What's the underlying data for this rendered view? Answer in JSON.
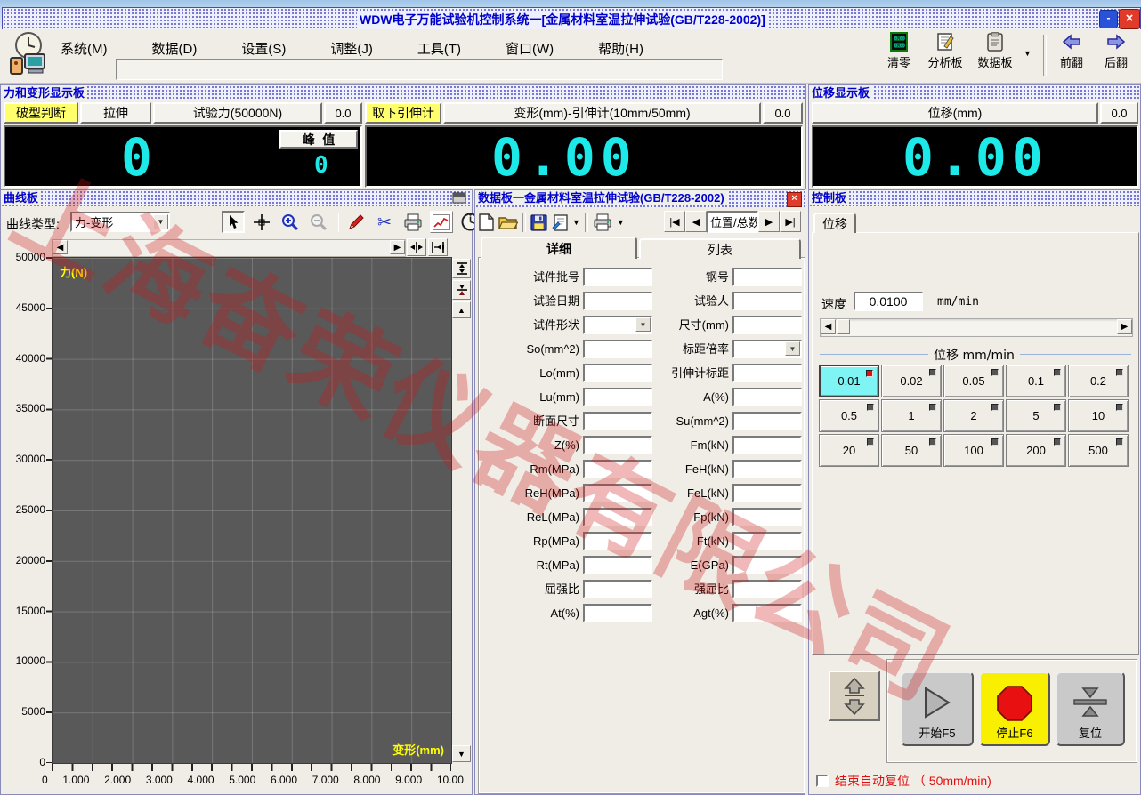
{
  "window": {
    "title": "WDW电子万能试验机控制系统一[金属材料室温拉伸试验(GB/T228-2002)]",
    "minimize_label": "-",
    "close_label": "×"
  },
  "menu": {
    "items": [
      "系统(M)",
      "数据(D)",
      "设置(S)",
      "调整(J)",
      "工具(T)",
      "窗口(W)",
      "帮助(H)"
    ]
  },
  "toolbar": {
    "clear_zero": "清零",
    "analysis_board": "分析板",
    "data_board": "数据板",
    "prev_page": "前翻",
    "next_page": "后翻"
  },
  "force_panel": {
    "title": "力和变形显示板",
    "break_judge_label": "破型判断",
    "tensile_label": "拉伸",
    "force_header": "试验力(50000N)",
    "force_small_value": "0.0",
    "force_display": "0",
    "peak_label": "峰 值",
    "peak_value": "0",
    "remove_extensometer_label": "取下引伸计",
    "deform_header": "变形(mm)-引伸计(10mm/50mm)",
    "deform_small_value": "0.0",
    "deform_display": "0.00"
  },
  "displacement_panel": {
    "title": "位移显示板",
    "header": "位移(mm)",
    "small_value": "0.0",
    "display": "0.00"
  },
  "curve_panel": {
    "title": "曲线板",
    "curve_type_label": "曲线类型:",
    "curve_type_value": "力-变形"
  },
  "chart_data": {
    "type": "line",
    "title": "",
    "xlabel": "变形(mm)",
    "ylabel": "力(N)",
    "xlim": [
      0,
      10
    ],
    "ylim": [
      0,
      50000
    ],
    "x_tick_labels": [
      "0",
      "1.000",
      "2.000",
      "3.000",
      "4.000",
      "5.000",
      "6.000",
      "7.000",
      "8.000",
      "9.000",
      "10.00"
    ],
    "y_tick_labels": [
      "50000",
      "45000",
      "40000",
      "35000",
      "30000",
      "25000",
      "20000",
      "15000",
      "10000",
      "5000",
      "0"
    ],
    "grid": true,
    "series": [],
    "plot_bg": "#595959",
    "axis_label_color": "#ffff00"
  },
  "data_panel": {
    "title": "数据板一金属材料室温拉伸试验(GB/T228-2002)",
    "close_label": "×",
    "position_label": "位置/总数",
    "tabs": [
      "详细",
      "列表"
    ],
    "rows": [
      {
        "left_label": "试件批号",
        "left_value": "",
        "right_label": "钢号",
        "right_value": ""
      },
      {
        "left_label": "试验日期",
        "left_value": "",
        "right_label": "试验人",
        "right_value": ""
      },
      {
        "left_label": "试件形状",
        "left_value": "",
        "right_label": "尺寸(mm)",
        "right_value": ""
      },
      {
        "left_label": "So(mm^2)",
        "left_value": "",
        "right_label": "标距倍率",
        "right_value": ""
      },
      {
        "left_label": "Lo(mm)",
        "left_value": "",
        "right_label": "引伸计标距",
        "right_value": ""
      },
      {
        "left_label": "Lu(mm)",
        "left_value": "",
        "right_label": "A(%)",
        "right_value": ""
      },
      {
        "left_label": "断面尺寸",
        "left_value": "",
        "right_label": "Su(mm^2)",
        "right_value": ""
      },
      {
        "left_label": "Z(%)",
        "left_value": "",
        "right_label": "Fm(kN)",
        "right_value": ""
      },
      {
        "left_label": "Rm(MPa)",
        "left_value": "",
        "right_label": "FeH(kN)",
        "right_value": ""
      },
      {
        "left_label": "ReH(MPa)",
        "left_value": "",
        "right_label": "FeL(kN)",
        "right_value": ""
      },
      {
        "left_label": "ReL(MPa)",
        "left_value": "",
        "right_label": "Fp(kN)",
        "right_value": ""
      },
      {
        "left_label": "Rp(MPa)",
        "left_value": "",
        "right_label": "Ft(kN)",
        "right_value": ""
      },
      {
        "left_label": "Rt(MPa)",
        "left_value": "",
        "right_label": "E(GPa)",
        "right_value": ""
      },
      {
        "left_label": "屈强比",
        "left_value": "",
        "right_label": "强屈比",
        "right_value": ""
      },
      {
        "left_label": "At(%)",
        "left_value": "",
        "right_label": "Agt(%)",
        "right_value": ""
      }
    ]
  },
  "control_panel": {
    "title": "控制板",
    "tab_label": "位移",
    "speed_label": "速度",
    "speed_value": "0.0100",
    "speed_unit": "mm/min",
    "group_label": "位移 mm/min",
    "speed_buttons": [
      "0.01",
      "0.02",
      "0.05",
      "0.1",
      "0.2",
      "0.5",
      "1",
      "2",
      "5",
      "10",
      "20",
      "50",
      "100",
      "200",
      "500"
    ],
    "selected_speed": "0.01",
    "start_label": "开始F5",
    "stop_label": "停止F6",
    "reset_label": "复位",
    "auto_reset_label": "结束自动复位 （ 50mm/min)",
    "auto_reset_checked": false
  },
  "watermark": {
    "text": "上海奋荣仪器有限公司",
    "color": "#cc1414"
  }
}
